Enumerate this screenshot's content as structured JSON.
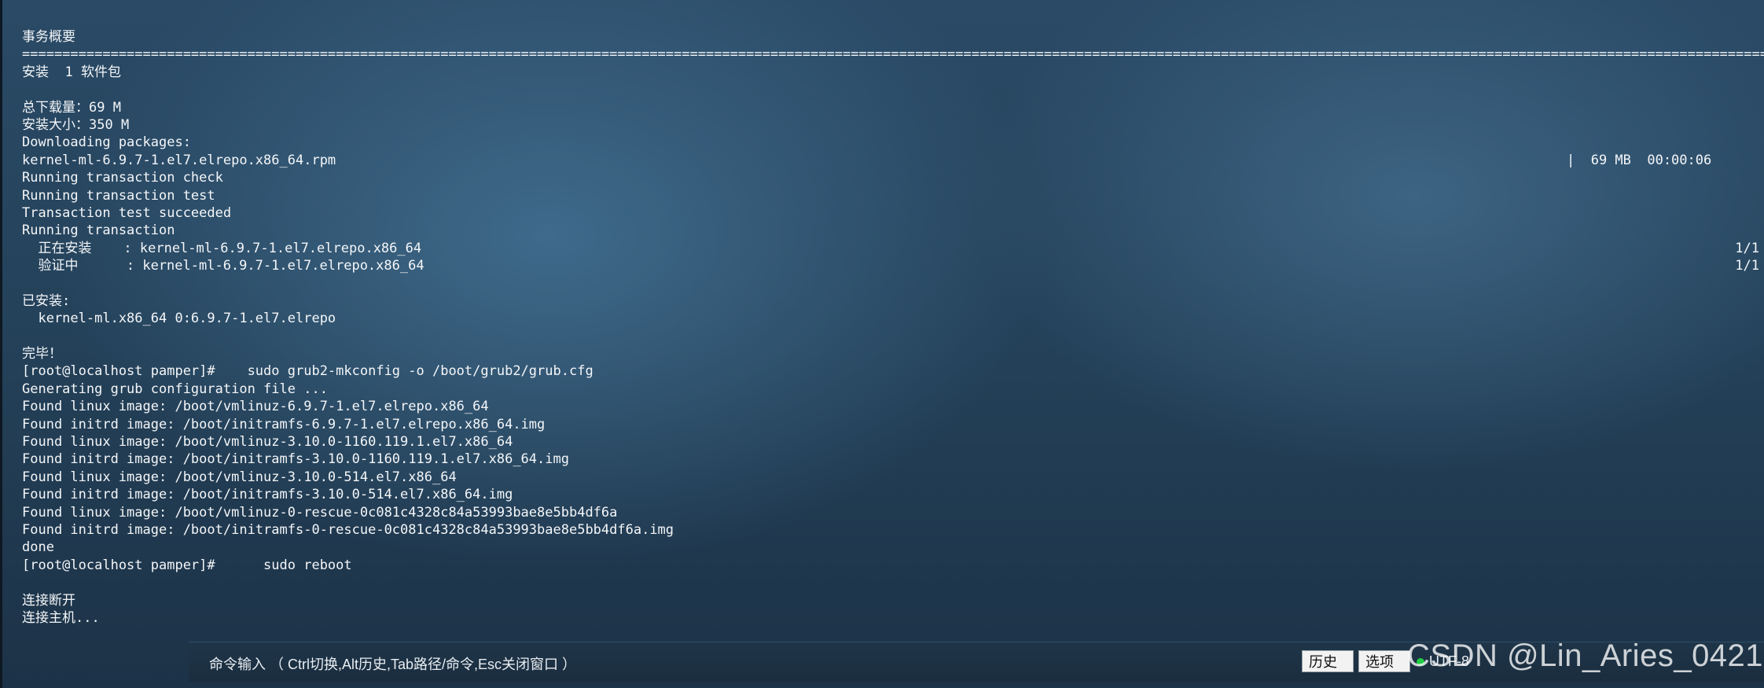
{
  "terminal": {
    "lines": [
      {
        "text": "事务概要"
      },
      {
        "text": "=============================================================================================================================================================================================================================="
      },
      {
        "text": "安装  1 软件包"
      },
      {
        "text": ""
      },
      {
        "text": "总下载量：69 M"
      },
      {
        "text": "安装大小：350 M"
      },
      {
        "text": "Downloading packages:"
      },
      {
        "text": "kernel-ml-6.9.7-1.el7.elrepo.x86_64.rpm",
        "right": "|  69 MB  00:00:06"
      },
      {
        "text": "Running transaction check"
      },
      {
        "text": "Running transaction test"
      },
      {
        "text": "Transaction test succeeded"
      },
      {
        "text": "Running transaction"
      },
      {
        "text": "  正在安装    : kernel-ml-6.9.7-1.el7.elrepo.x86_64",
        "far_right": "1/1"
      },
      {
        "text": "  验证中      : kernel-ml-6.9.7-1.el7.elrepo.x86_64",
        "far_right": "1/1"
      },
      {
        "text": ""
      },
      {
        "text": "已安装:"
      },
      {
        "text": "  kernel-ml.x86_64 0:6.9.7-1.el7.elrepo"
      },
      {
        "text": ""
      },
      {
        "text": "完毕！"
      },
      {
        "text": "[root@localhost pamper]#    sudo grub2-mkconfig -o /boot/grub2/grub.cfg"
      },
      {
        "text": "Generating grub configuration file ..."
      },
      {
        "text": "Found linux image: /boot/vmlinuz-6.9.7-1.el7.elrepo.x86_64"
      },
      {
        "text": "Found initrd image: /boot/initramfs-6.9.7-1.el7.elrepo.x86_64.img"
      },
      {
        "text": "Found linux image: /boot/vmlinuz-3.10.0-1160.119.1.el7.x86_64"
      },
      {
        "text": "Found initrd image: /boot/initramfs-3.10.0-1160.119.1.el7.x86_64.img"
      },
      {
        "text": "Found linux image: /boot/vmlinuz-3.10.0-514.el7.x86_64"
      },
      {
        "text": "Found initrd image: /boot/initramfs-3.10.0-514.el7.x86_64.img"
      },
      {
        "text": "Found linux image: /boot/vmlinuz-0-rescue-0c081c4328c84a53993bae8e5bb4df6a"
      },
      {
        "text": "Found initrd image: /boot/initramfs-0-rescue-0c081c4328c84a53993bae8e5bb4df6a.img"
      },
      {
        "text": "done"
      },
      {
        "text": "[root@localhost pamper]#      sudo reboot"
      },
      {
        "text": ""
      },
      {
        "text": "连接断开"
      },
      {
        "text": "连接主机..."
      }
    ]
  },
  "command_bar": {
    "label": "命令输入 （ Ctrl切换,Alt历史,Tab路径/命令,Esc关闭窗口 ）",
    "history_button": "历史",
    "options_button": "选项",
    "encoding": "UTF-8"
  },
  "watermark": "CSDN @Lin_Aries_0421",
  "colors": {
    "text": "#f4f6f8",
    "background": "#2a4a66",
    "status_dot": "#22cc44"
  }
}
